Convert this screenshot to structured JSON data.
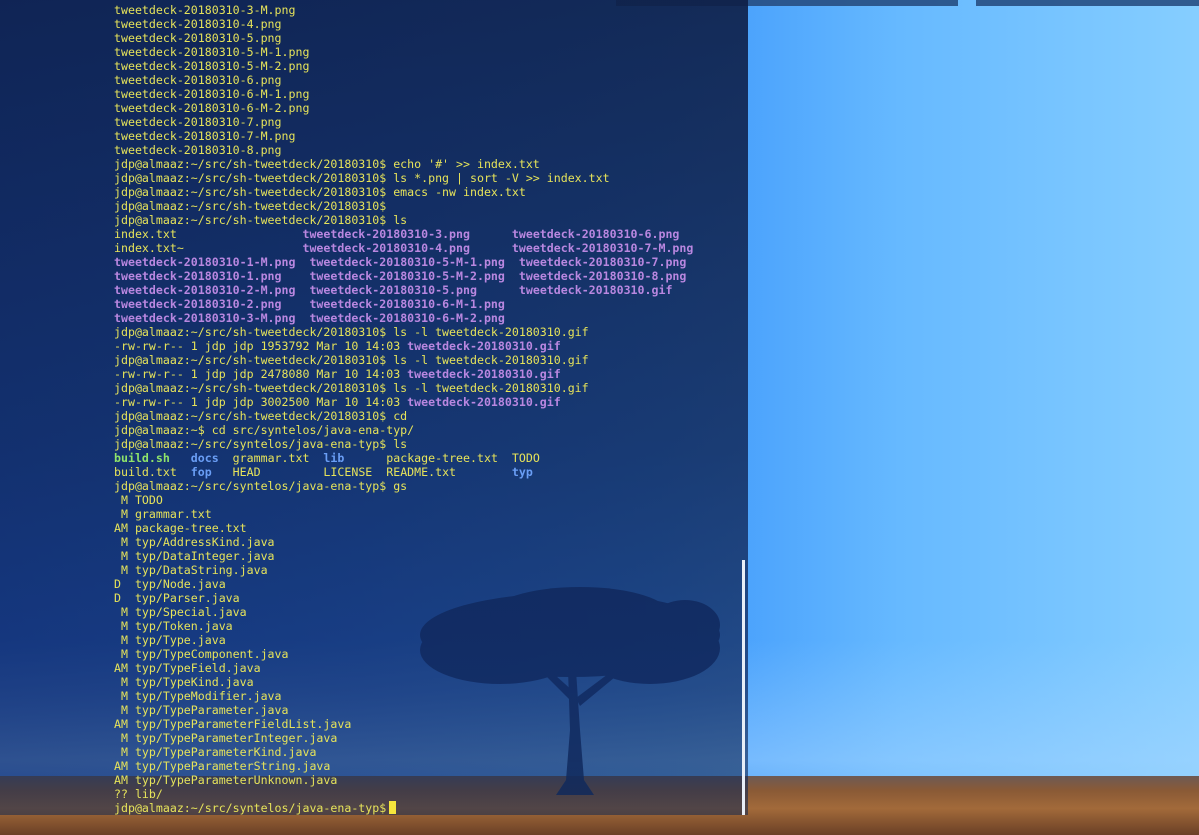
{
  "terminal": {
    "lines": [
      {
        "segs": [
          {
            "t": "tweetdeck-20180310-3-M.png",
            "c": "y"
          }
        ]
      },
      {
        "segs": [
          {
            "t": "tweetdeck-20180310-4.png",
            "c": "y"
          }
        ]
      },
      {
        "segs": [
          {
            "t": "tweetdeck-20180310-5.png",
            "c": "y"
          }
        ]
      },
      {
        "segs": [
          {
            "t": "tweetdeck-20180310-5-M-1.png",
            "c": "y"
          }
        ]
      },
      {
        "segs": [
          {
            "t": "tweetdeck-20180310-5-M-2.png",
            "c": "y"
          }
        ]
      },
      {
        "segs": [
          {
            "t": "tweetdeck-20180310-6.png",
            "c": "y"
          }
        ]
      },
      {
        "segs": [
          {
            "t": "tweetdeck-20180310-6-M-1.png",
            "c": "y"
          }
        ]
      },
      {
        "segs": [
          {
            "t": "tweetdeck-20180310-6-M-2.png",
            "c": "y"
          }
        ]
      },
      {
        "segs": [
          {
            "t": "tweetdeck-20180310-7.png",
            "c": "y"
          }
        ]
      },
      {
        "segs": [
          {
            "t": "tweetdeck-20180310-7-M.png",
            "c": "y"
          }
        ]
      },
      {
        "segs": [
          {
            "t": "tweetdeck-20180310-8.png",
            "c": "y"
          }
        ]
      },
      {
        "segs": [
          {
            "t": "jdp@almaaz:~/src/sh-tweetdeck/20180310$ echo '#' >> index.txt",
            "c": "y"
          }
        ]
      },
      {
        "segs": [
          {
            "t": "jdp@almaaz:~/src/sh-tweetdeck/20180310$ ls *.png | sort -V >> index.txt",
            "c": "y"
          }
        ]
      },
      {
        "segs": [
          {
            "t": "jdp@almaaz:~/src/sh-tweetdeck/20180310$ emacs -nw index.txt",
            "c": "y"
          }
        ]
      },
      {
        "segs": [
          {
            "t": "jdp@almaaz:~/src/sh-tweetdeck/20180310$",
            "c": "y"
          }
        ]
      },
      {
        "segs": [
          {
            "t": "jdp@almaaz:~/src/sh-tweetdeck/20180310$ ls",
            "c": "y"
          }
        ]
      },
      {
        "segs": [
          {
            "t": "index.txt                  ",
            "c": "y"
          },
          {
            "t": "tweetdeck-20180310-3.png",
            "c": "p"
          },
          {
            "t": "      ",
            "c": "y"
          },
          {
            "t": "tweetdeck-20180310-6.png",
            "c": "p"
          }
        ]
      },
      {
        "segs": [
          {
            "t": "index.txt~                 ",
            "c": "y"
          },
          {
            "t": "tweetdeck-20180310-4.png",
            "c": "p"
          },
          {
            "t": "      ",
            "c": "y"
          },
          {
            "t": "tweetdeck-20180310-7-M.png",
            "c": "p"
          }
        ]
      },
      {
        "segs": [
          {
            "t": "tweetdeck-20180310-1-M.png",
            "c": "p"
          },
          {
            "t": "  ",
            "c": "y"
          },
          {
            "t": "tweetdeck-20180310-5-M-1.png",
            "c": "p"
          },
          {
            "t": "  ",
            "c": "y"
          },
          {
            "t": "tweetdeck-20180310-7.png",
            "c": "p"
          }
        ]
      },
      {
        "segs": [
          {
            "t": "tweetdeck-20180310-1.png",
            "c": "p"
          },
          {
            "t": "    ",
            "c": "y"
          },
          {
            "t": "tweetdeck-20180310-5-M-2.png",
            "c": "p"
          },
          {
            "t": "  ",
            "c": "y"
          },
          {
            "t": "tweetdeck-20180310-8.png",
            "c": "p"
          }
        ]
      },
      {
        "segs": [
          {
            "t": "tweetdeck-20180310-2-M.png",
            "c": "p"
          },
          {
            "t": "  ",
            "c": "y"
          },
          {
            "t": "tweetdeck-20180310-5.png",
            "c": "p"
          },
          {
            "t": "      ",
            "c": "y"
          },
          {
            "t": "tweetdeck-20180310.gif",
            "c": "p"
          }
        ]
      },
      {
        "segs": [
          {
            "t": "tweetdeck-20180310-2.png",
            "c": "p"
          },
          {
            "t": "    ",
            "c": "y"
          },
          {
            "t": "tweetdeck-20180310-6-M-1.png",
            "c": "p"
          }
        ]
      },
      {
        "segs": [
          {
            "t": "tweetdeck-20180310-3-M.png",
            "c": "p"
          },
          {
            "t": "  ",
            "c": "y"
          },
          {
            "t": "tweetdeck-20180310-6-M-2.png",
            "c": "p"
          }
        ]
      },
      {
        "segs": [
          {
            "t": "jdp@almaaz:~/src/sh-tweetdeck/20180310$ ls -l tweetdeck-20180310.gif",
            "c": "y"
          }
        ]
      },
      {
        "segs": [
          {
            "t": "-rw-rw-r-- 1 jdp jdp 1953792 Mar 10 14:03 ",
            "c": "y"
          },
          {
            "t": "tweetdeck-20180310.gif",
            "c": "p"
          }
        ]
      },
      {
        "segs": [
          {
            "t": "jdp@almaaz:~/src/sh-tweetdeck/20180310$ ls -l tweetdeck-20180310.gif",
            "c": "y"
          }
        ]
      },
      {
        "segs": [
          {
            "t": "-rw-rw-r-- 1 jdp jdp 2478080 Mar 10 14:03 ",
            "c": "y"
          },
          {
            "t": "tweetdeck-20180310.gif",
            "c": "p"
          }
        ]
      },
      {
        "segs": [
          {
            "t": "jdp@almaaz:~/src/sh-tweetdeck/20180310$ ls -l tweetdeck-20180310.gif",
            "c": "y"
          }
        ]
      },
      {
        "segs": [
          {
            "t": "-rw-rw-r-- 1 jdp jdp 3002500 Mar 10 14:03 ",
            "c": "y"
          },
          {
            "t": "tweetdeck-20180310.gif",
            "c": "p"
          }
        ]
      },
      {
        "segs": [
          {
            "t": "jdp@almaaz:~/src/sh-tweetdeck/20180310$ cd",
            "c": "y"
          }
        ]
      },
      {
        "segs": [
          {
            "t": "jdp@almaaz:~$ cd src/syntelos/java-ena-typ/",
            "c": "y"
          }
        ]
      },
      {
        "segs": [
          {
            "t": "jdp@almaaz:~/src/syntelos/java-ena-typ$ ls",
            "c": "y"
          }
        ]
      },
      {
        "segs": [
          {
            "t": "build.sh",
            "c": "g"
          },
          {
            "t": "   ",
            "c": "y"
          },
          {
            "t": "docs",
            "c": "b"
          },
          {
            "t": "  grammar.txt  ",
            "c": "y"
          },
          {
            "t": "lib",
            "c": "b"
          },
          {
            "t": "      package-tree.txt  TODO",
            "c": "y"
          }
        ]
      },
      {
        "segs": [
          {
            "t": "build.txt  ",
            "c": "y"
          },
          {
            "t": "fop",
            "c": "b"
          },
          {
            "t": "   HEAD         LICENSE  README.txt        ",
            "c": "y"
          },
          {
            "t": "typ",
            "c": "b"
          }
        ]
      },
      {
        "segs": [
          {
            "t": "jdp@almaaz:~/src/syntelos/java-ena-typ$ gs",
            "c": "y"
          }
        ]
      },
      {
        "segs": [
          {
            "t": " M TODO",
            "c": "y"
          }
        ]
      },
      {
        "segs": [
          {
            "t": " M grammar.txt",
            "c": "y"
          }
        ]
      },
      {
        "segs": [
          {
            "t": "AM package-tree.txt",
            "c": "y"
          }
        ]
      },
      {
        "segs": [
          {
            "t": " M typ/AddressKind.java",
            "c": "y"
          }
        ]
      },
      {
        "segs": [
          {
            "t": " M typ/DataInteger.java",
            "c": "y"
          }
        ]
      },
      {
        "segs": [
          {
            "t": " M typ/DataString.java",
            "c": "y"
          }
        ]
      },
      {
        "segs": [
          {
            "t": "D  typ/Node.java",
            "c": "y"
          }
        ]
      },
      {
        "segs": [
          {
            "t": "D  typ/Parser.java",
            "c": "y"
          }
        ]
      },
      {
        "segs": [
          {
            "t": " M typ/Special.java",
            "c": "y"
          }
        ]
      },
      {
        "segs": [
          {
            "t": " M typ/Token.java",
            "c": "y"
          }
        ]
      },
      {
        "segs": [
          {
            "t": " M typ/Type.java",
            "c": "y"
          }
        ]
      },
      {
        "segs": [
          {
            "t": " M typ/TypeComponent.java",
            "c": "y"
          }
        ]
      },
      {
        "segs": [
          {
            "t": "AM typ/TypeField.java",
            "c": "y"
          }
        ]
      },
      {
        "segs": [
          {
            "t": " M typ/TypeKind.java",
            "c": "y"
          }
        ]
      },
      {
        "segs": [
          {
            "t": " M typ/TypeModifier.java",
            "c": "y"
          }
        ]
      },
      {
        "segs": [
          {
            "t": " M typ/TypeParameter.java",
            "c": "y"
          }
        ]
      },
      {
        "segs": [
          {
            "t": "AM typ/TypeParameterFieldList.java",
            "c": "y"
          }
        ]
      },
      {
        "segs": [
          {
            "t": " M typ/TypeParameterInteger.java",
            "c": "y"
          }
        ]
      },
      {
        "segs": [
          {
            "t": " M typ/TypeParameterKind.java",
            "c": "y"
          }
        ]
      },
      {
        "segs": [
          {
            "t": "AM typ/TypeParameterString.java",
            "c": "y"
          }
        ]
      },
      {
        "segs": [
          {
            "t": "AM typ/TypeParameterUnknown.java",
            "c": "y"
          }
        ]
      },
      {
        "segs": [
          {
            "t": "?? lib/",
            "c": "y"
          }
        ]
      }
    ],
    "prompt": "jdp@almaaz:~/src/syntelos/java-ena-typ$"
  },
  "colors": {
    "text": "#e6e35a",
    "executable": "#8fe36a",
    "directory": "#6a9ef5",
    "media_file": "#b987e0",
    "cursor": "#f5e63c",
    "terminal_bg": "#102656"
  },
  "icons": {
    "cursor": "block-cursor-icon"
  }
}
